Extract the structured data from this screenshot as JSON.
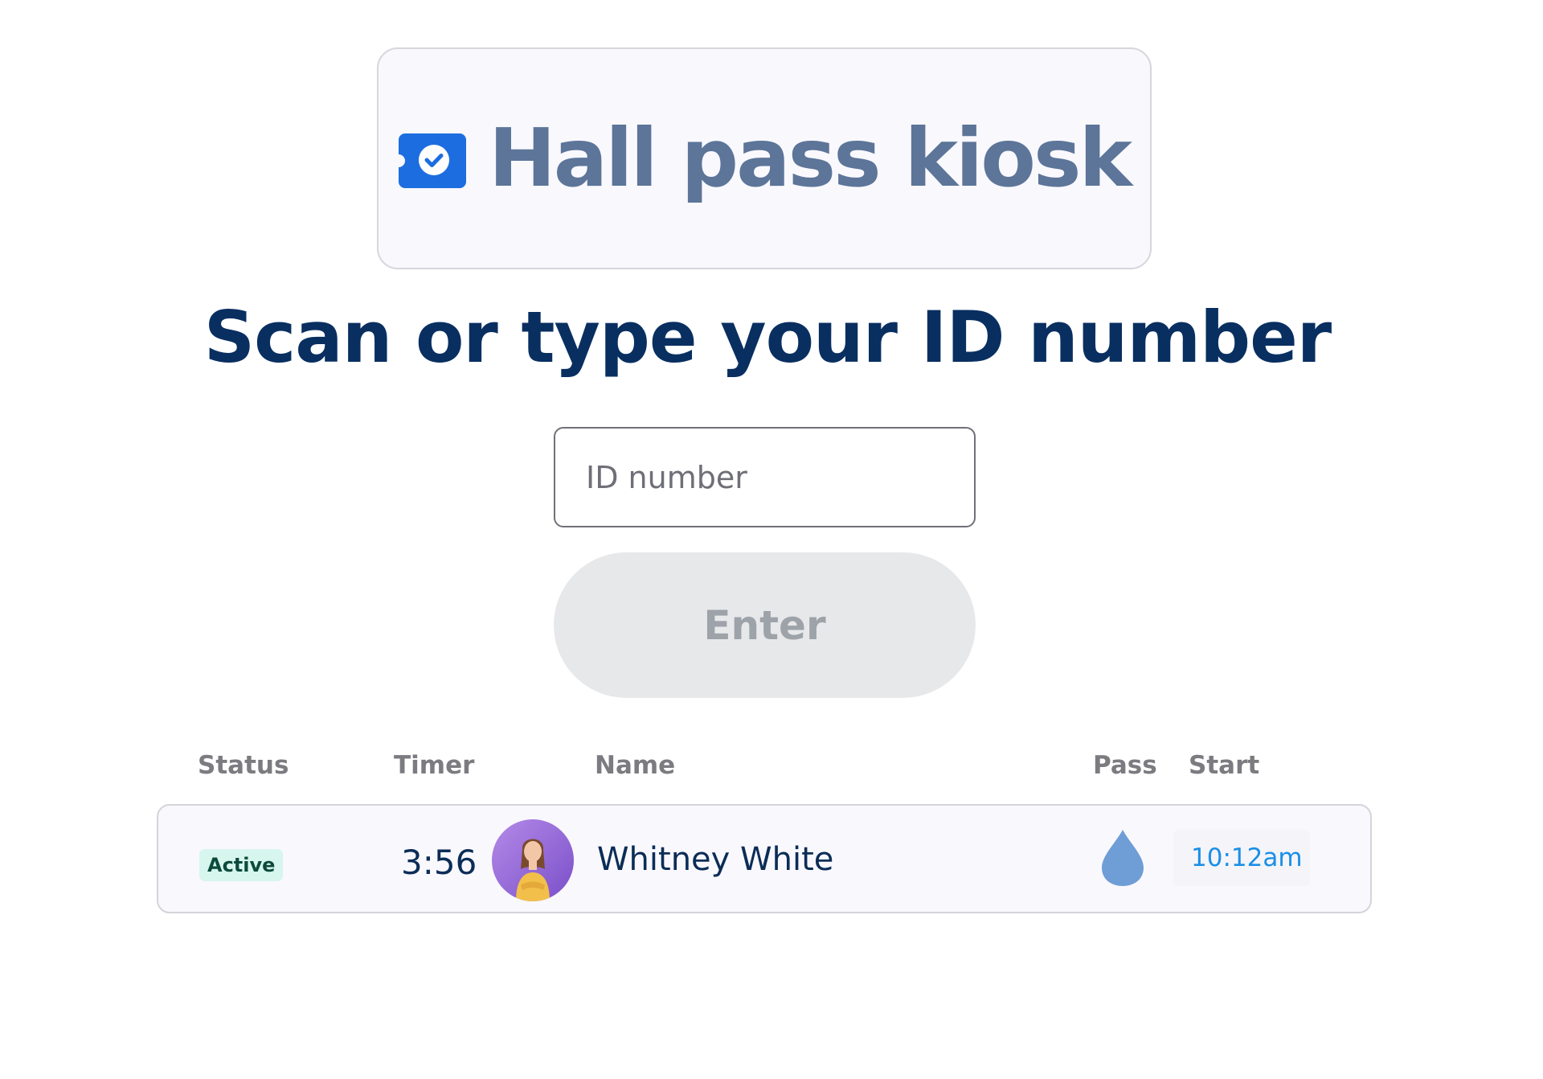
{
  "brand": {
    "title": "Hall pass kiosk",
    "logo_icon": "ticket-check-icon",
    "logo_color": "#1c6ee0"
  },
  "heading": "Scan or type your ID number",
  "id_input": {
    "placeholder": "ID number",
    "value": ""
  },
  "enter_button": {
    "label": "Enter",
    "state": "disabled"
  },
  "table": {
    "columns": [
      "Status",
      "Timer",
      "Name",
      "Pass",
      "Start"
    ],
    "rows": [
      {
        "status": "Active",
        "timer": "3:56",
        "avatar": "student-avatar",
        "name": "Whitney White",
        "pass_icon": "water-drop-icon",
        "start": "10:12am"
      }
    ]
  },
  "colors": {
    "heading": "#092f61",
    "brand_text": "#5c7599",
    "status_active_bg": "#d6f6ee",
    "status_active_text": "#0c4a3c",
    "start_time": "#1a8fe6",
    "pass_icon": "#6f9ed6"
  }
}
